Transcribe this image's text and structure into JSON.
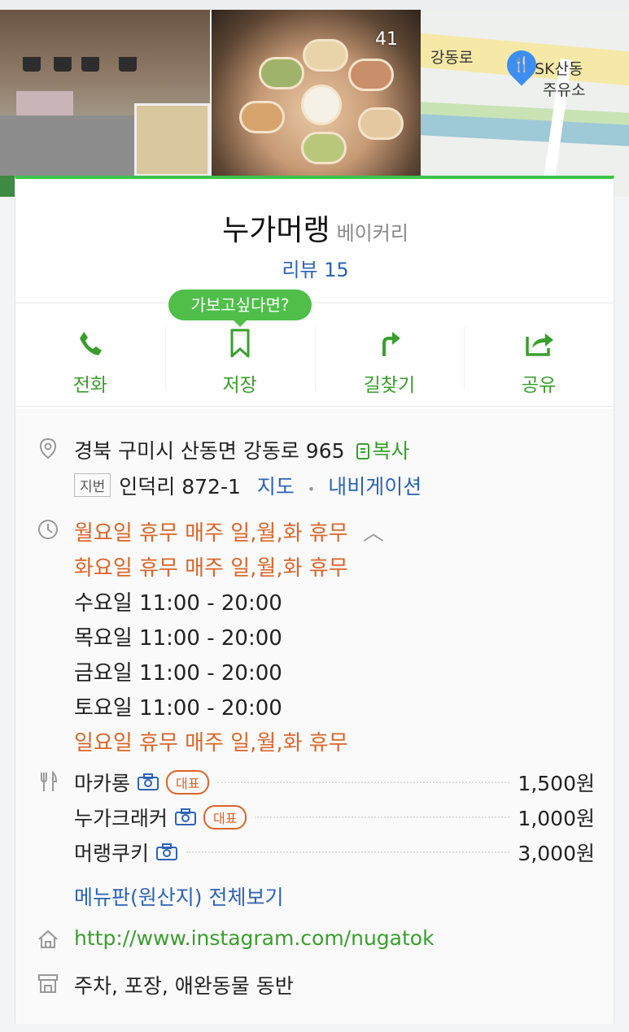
{
  "gallery": {
    "photo_count": "41"
  },
  "map": {
    "road_label": "강동로",
    "poi_label_1": "SK산동",
    "poi_label_2": "주유소"
  },
  "place": {
    "name": "누가머랭",
    "category": "베이커리",
    "review_label": "리뷰 15"
  },
  "tooltip": "가보고싶다면?",
  "actions": [
    {
      "label": "전화",
      "icon": "phone-icon"
    },
    {
      "label": "저장",
      "icon": "bookmark-icon"
    },
    {
      "label": "길찾기",
      "icon": "directions-icon"
    },
    {
      "label": "공유",
      "icon": "share-icon"
    }
  ],
  "address": {
    "road": "경북 구미시 산동면 강동로 965",
    "copy_label": "복사",
    "lot_tag": "지번",
    "lot": "인덕리 872-1",
    "map_link": "지도",
    "nav_link": "내비게이션"
  },
  "hours": [
    {
      "text": "월요일 휴무 매주 일,월,화 휴무",
      "closed": true
    },
    {
      "text": "화요일 휴무 매주 일,월,화 휴무",
      "closed": true
    },
    {
      "text": "수요일 11:00 - 20:00",
      "closed": false
    },
    {
      "text": "목요일 11:00 - 20:00",
      "closed": false
    },
    {
      "text": "금요일 11:00 - 20:00",
      "closed": false
    },
    {
      "text": "토요일 11:00 - 20:00",
      "closed": false
    },
    {
      "text": "일요일 휴무 매주 일,월,화 휴무",
      "closed": true
    }
  ],
  "menu": {
    "items": [
      {
        "name": "마카롱",
        "badge": "대표",
        "price": "1,500원"
      },
      {
        "name": "누가크래커",
        "badge": "대표",
        "price": "1,000원"
      },
      {
        "name": "머랭쿠키",
        "badge": "",
        "price": "3,000원"
      }
    ],
    "view_all": "메뉴판(원산지) 전체보기"
  },
  "website": "http://www.instagram.com/nugatok",
  "amenities": "주차, 포장, 애완동물 동반",
  "colors": {
    "accent_green": "#3cc34b",
    "link_blue": "#2d63b8",
    "closed_orange": "#d9652a"
  }
}
